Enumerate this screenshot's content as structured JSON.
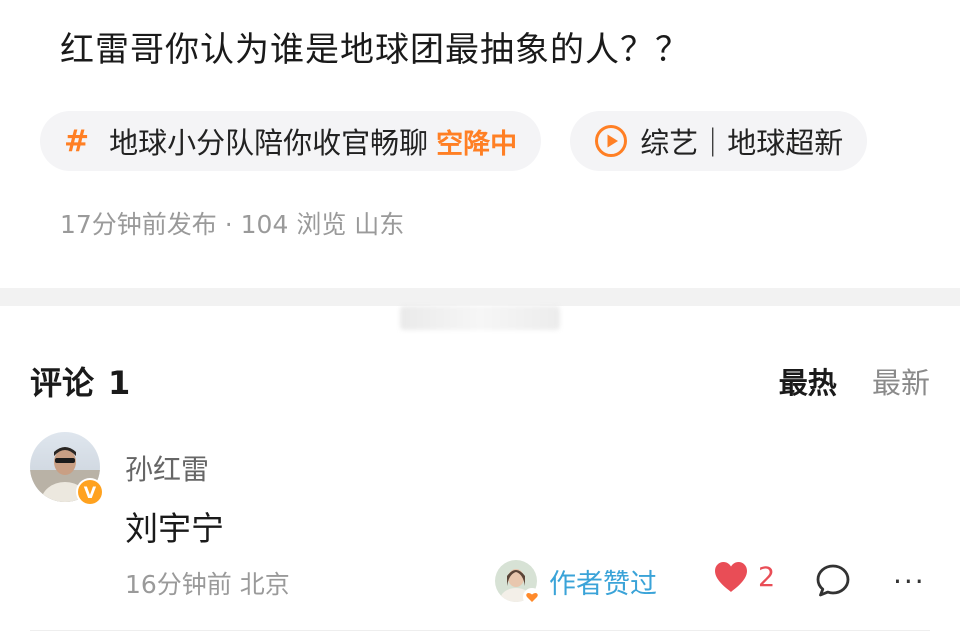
{
  "post": {
    "question": "红雷哥你认为谁是地球团最抽象的人？？",
    "chips": [
      {
        "icon": "hashtag-icon",
        "label": "地球小分队陪你收官畅聊",
        "live_label": "空降中"
      },
      {
        "icon": "play-circle-icon",
        "label": "综艺｜地球超新"
      }
    ],
    "meta": "17分钟前发布 · 104 浏览 山东"
  },
  "comments": {
    "title": "评论",
    "count": "1",
    "sort": {
      "hot": "最热",
      "new": "最新"
    },
    "items": [
      {
        "username": "孙红雷",
        "verified_badge": "V",
        "text": "刘宇宁",
        "meta": "16分钟前 北京",
        "author_liked_label": "作者赞过",
        "like_count": "2"
      }
    ]
  },
  "colors": {
    "accent_orange": "#ff7f24",
    "like_red": "#e94d56",
    "author_blue": "#3aa3d8",
    "badge_orange": "#ffa21f"
  }
}
